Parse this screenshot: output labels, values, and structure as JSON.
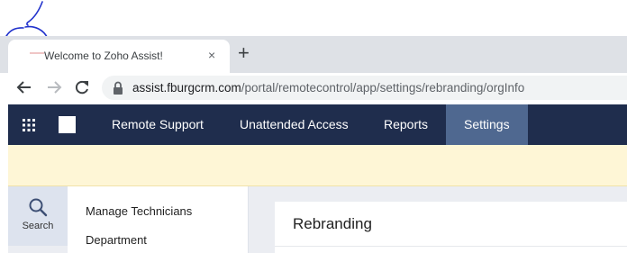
{
  "browser": {
    "tab": {
      "title": "Welcome to Zoho Assist!",
      "close_glyph": "×"
    },
    "new_tab_glyph": "+",
    "url": {
      "host": "assist.fburgcrm.com",
      "path": "/portal/remotecontrol/app/settings/rebranding/orgInfo"
    }
  },
  "app": {
    "nav": [
      {
        "label": "Remote Support",
        "active": false
      },
      {
        "label": "Unattended Access",
        "active": false
      },
      {
        "label": "Reports",
        "active": false
      },
      {
        "label": "Settings",
        "active": true
      }
    ],
    "search": {
      "label": "Search"
    },
    "sidebar": {
      "items": [
        {
          "label": "Manage Technicians"
        },
        {
          "label": "Department"
        }
      ]
    },
    "panel": {
      "title": "Rebranding"
    }
  },
  "colors": {
    "nav_bg": "#1f2d4d",
    "nav_active": "#4f6890",
    "banner": "#fef6d6",
    "annotation_ink": "#2233cc"
  }
}
